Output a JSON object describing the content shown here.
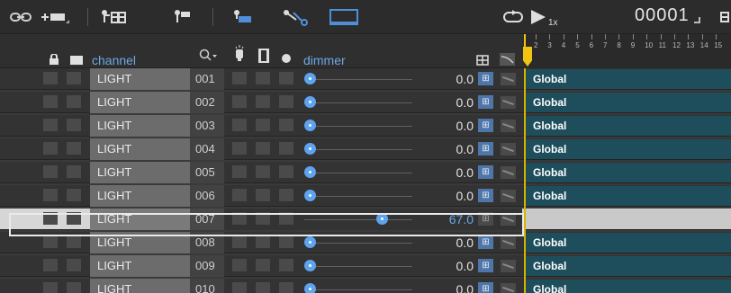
{
  "toolbar": {
    "link_icon": "link-icon",
    "add_icon": "add-channel-icon",
    "group_icon": "group-icon",
    "pin_icon": "pin-icon",
    "flag_icon": "flag-icon",
    "scissors_icon": "scissors-icon",
    "monitor_icon": "monitor-icon",
    "loop_icon": "loop-icon",
    "play_icon": "play-icon",
    "speed": "1x",
    "frame": "00001"
  },
  "header": {
    "channel_label": "channel",
    "dimmer_label": "dimmer",
    "lock_icon": "lock-icon",
    "box_icon": "square-icon",
    "search_icon": "search-icon",
    "bulb_icon": "bulb-icon",
    "solo_icon": "solo-icon",
    "dot_icon": "dot-icon"
  },
  "ruler": [
    "2",
    "3",
    "4",
    "5",
    "6",
    "7",
    "8",
    "9",
    "10",
    "11",
    "12",
    "13",
    "14",
    "15"
  ],
  "rows": [
    {
      "type": "LIGHT",
      "num": "001",
      "value": "0.0",
      "cell": "Global",
      "knob": 0.0
    },
    {
      "type": "LIGHT",
      "num": "002",
      "value": "0.0",
      "cell": "Global",
      "knob": 0.0
    },
    {
      "type": "LIGHT",
      "num": "003",
      "value": "0.0",
      "cell": "Global",
      "knob": 0.0
    },
    {
      "type": "LIGHT",
      "num": "004",
      "value": "0.0",
      "cell": "Global",
      "knob": 0.0
    },
    {
      "type": "LIGHT",
      "num": "005",
      "value": "0.0",
      "cell": "Global",
      "knob": 0.0
    },
    {
      "type": "LIGHT",
      "num": "006",
      "value": "0.0",
      "cell": "Global",
      "knob": 0.0
    },
    {
      "type": "LIGHT",
      "num": "007",
      "value": "67.0",
      "cell": "",
      "knob": 0.67,
      "selected": true
    },
    {
      "type": "LIGHT",
      "num": "008",
      "value": "0.0",
      "cell": "Global",
      "knob": 0.0
    },
    {
      "type": "LIGHT",
      "num": "009",
      "value": "0.0",
      "cell": "Global",
      "knob": 0.0
    },
    {
      "type": "LIGHT",
      "num": "010",
      "value": "0.0",
      "cell": "Global",
      "knob": 0.0
    }
  ]
}
